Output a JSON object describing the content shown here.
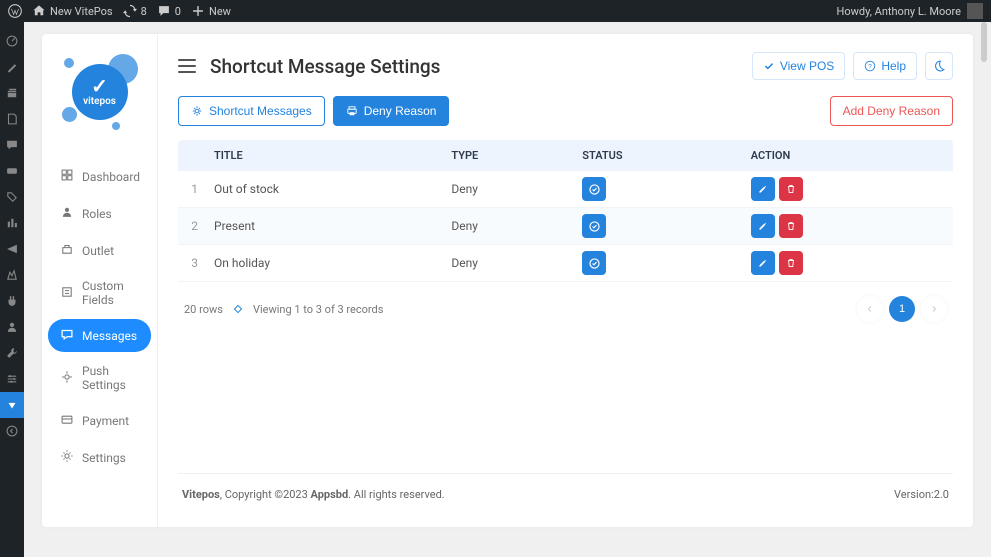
{
  "adminBar": {
    "site": "New VitePos",
    "updates": "8",
    "comments": "0",
    "newLabel": "New",
    "howdy": "Howdy, Anthony L. Moore"
  },
  "page": {
    "title": "Shortcut Message Settings"
  },
  "headerActions": {
    "viewPos": "View POS",
    "help": "Help"
  },
  "toolbar": {
    "shortcutMessages": "Shortcut Messages",
    "denyReason": "Deny Reason",
    "addDenyReason": "Add Deny Reason"
  },
  "sidebarNav": [
    {
      "label": "Dashboard"
    },
    {
      "label": "Roles"
    },
    {
      "label": "Outlet"
    },
    {
      "label": "Custom Fields"
    },
    {
      "label": "Messages"
    },
    {
      "label": "Push Settings"
    },
    {
      "label": "Payment"
    },
    {
      "label": "Settings"
    }
  ],
  "table": {
    "headers": {
      "title": "TITLE",
      "type": "TYPE",
      "status": "STATUS",
      "action": "ACTION"
    },
    "rows": [
      {
        "n": "1",
        "title": "Out of stock",
        "type": "Deny"
      },
      {
        "n": "2",
        "title": "Present",
        "type": "Deny"
      },
      {
        "n": "3",
        "title": "On holiday",
        "type": "Deny"
      }
    ]
  },
  "tableFooter": {
    "rowsLabel": "20 rows",
    "viewing": "Viewing 1 to 3 of 3 records",
    "page": "1"
  },
  "footer": {
    "brand": "Vitepos",
    "copyright": ", Copyright ©2023 ",
    "company": "Appsbd",
    "rights": ". All rights reserved.",
    "version": "Version:2.0"
  },
  "logoText": "vitepos"
}
